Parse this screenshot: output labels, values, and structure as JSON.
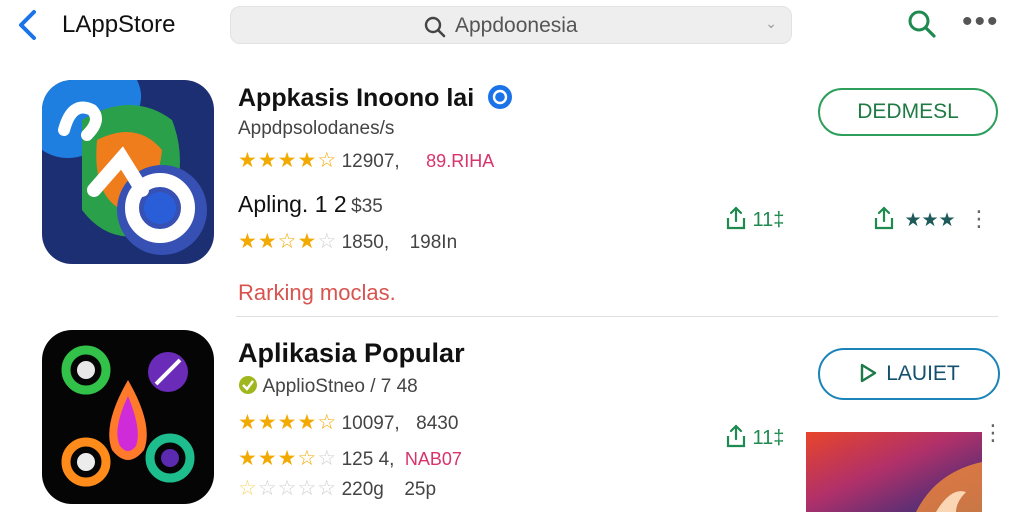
{
  "header": {
    "brand": "LAppStore",
    "search_text": "Appdoonesia",
    "colors": {
      "accent": "#1a73e8",
      "green": "#1e8a4f"
    }
  },
  "apps": [
    {
      "title": "Appkasis Inoono lai",
      "developer": "Appdpsolodanes/s",
      "rating_stars": 4.5,
      "rating_text": "12907,",
      "tag_text": "89.RIHA",
      "price_line": "Apling. 1 2",
      "price_small": "$35",
      "rating2_stars": 3.5,
      "rating2_text": "1850,",
      "rating2_extra": "198In",
      "note": "Rarking moclas.",
      "action_label": "DEDMESL",
      "share_count": "11‡",
      "mini_stars": "★★★"
    },
    {
      "title": "Aplikasia Popular",
      "developer": "ApplioStneo / 7 48",
      "rating_stars": 4.5,
      "rating_text": "10097,",
      "tag_text": "8430",
      "rating2_stars": 3.5,
      "rating2_text": "125 4,",
      "rating2_extra": "NAB07",
      "rating3_stars": 1,
      "rating3_text": "220g",
      "rating3_extra": "25p",
      "action_label": "LAUIET",
      "share_count": "11‡"
    }
  ]
}
